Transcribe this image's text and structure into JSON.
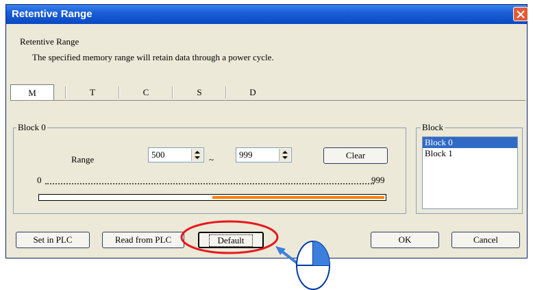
{
  "window": {
    "title": "Retentive Range"
  },
  "header": {
    "heading": "Retentive Range",
    "description": "The specified memory range will retain data through a power cycle."
  },
  "tabs": [
    {
      "label": "M",
      "active": true
    },
    {
      "label": "T",
      "active": false
    },
    {
      "label": "C",
      "active": false
    },
    {
      "label": "S",
      "active": false
    },
    {
      "label": "D",
      "active": false
    }
  ],
  "block_group": {
    "legend": "Block 0",
    "range_label": "Range",
    "range_start": "500",
    "range_separator": "~",
    "range_end": "999",
    "clear_label": "Clear",
    "scale_min": "0",
    "scale_max": "999",
    "bar_fill_start": 500,
    "bar_fill_end": 999,
    "bar_color": "#ff7f00"
  },
  "block_list": {
    "legend": "Block",
    "items": [
      "Block 0",
      "Block 1"
    ],
    "selected": "Block 0"
  },
  "buttons": {
    "set_in_plc": "Set in PLC",
    "read_from_plc": "Read from PLC",
    "default": "Default",
    "ok": "OK",
    "cancel": "Cancel"
  },
  "annotation": {
    "highlight_color": "#e8161e",
    "arrow_color": "#3d7fdd"
  }
}
